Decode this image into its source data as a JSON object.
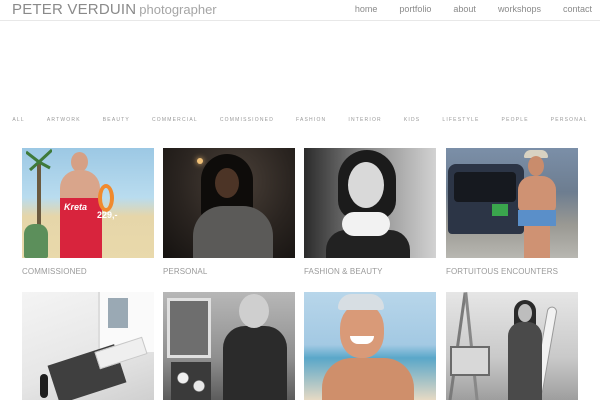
{
  "brand": {
    "name": "PETER VERDUIN",
    "subtitle": "photographer"
  },
  "nav": [
    {
      "label": "home"
    },
    {
      "label": "portfolio"
    },
    {
      "label": "about"
    },
    {
      "label": "workshops"
    },
    {
      "label": "contact"
    }
  ],
  "filters": [
    {
      "label": "ALL"
    },
    {
      "label": "ARTWORK"
    },
    {
      "label": "BEAUTY"
    },
    {
      "label": "COMMERCIAL"
    },
    {
      "label": "COMMISSIONED"
    },
    {
      "label": "FASHION"
    },
    {
      "label": "INTERIOR"
    },
    {
      "label": "KIDS"
    },
    {
      "label": "LIFESTYLE"
    },
    {
      "label": "PEOPLE"
    },
    {
      "label": "PERSONAL"
    }
  ],
  "tiles": [
    {
      "caption": "COMMISSIONED",
      "towel_text": "Kreta",
      "price": "229,-"
    },
    {
      "caption": "PERSONAL"
    },
    {
      "caption": "FASHION & BEAUTY"
    },
    {
      "caption": "FORTUITOUS ENCOUNTERS"
    },
    {
      "caption": ""
    },
    {
      "caption": ""
    },
    {
      "caption": ""
    },
    {
      "caption": ""
    }
  ]
}
